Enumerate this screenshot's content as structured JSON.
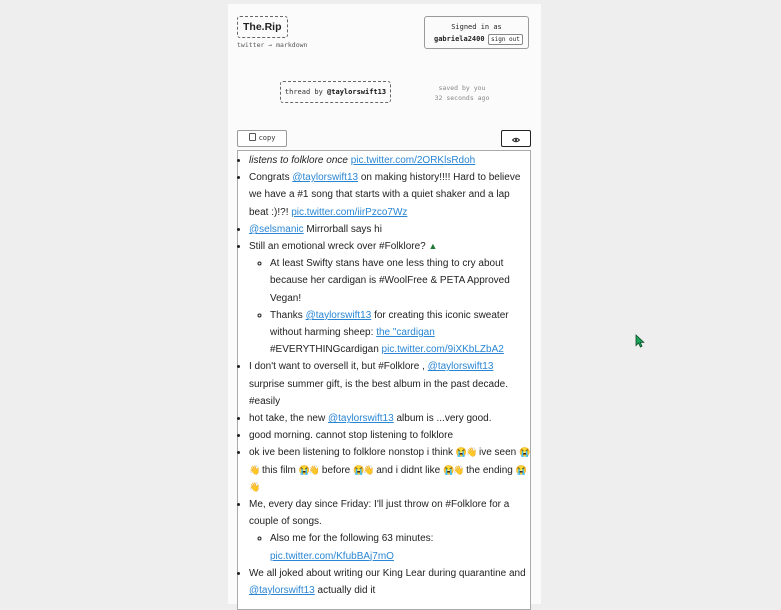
{
  "app": {
    "logo": "The.Rip",
    "tagline": "twitter → markdown"
  },
  "account": {
    "signed_in_label": "Signed in as",
    "username": "gabriela2400",
    "sign_out_label": "sign out"
  },
  "thread": {
    "prefix": "thread by",
    "handle": "@taylorswift13",
    "saved_line1": "saved by you",
    "saved_line2": "32 seconds ago"
  },
  "toolbar": {
    "copy_label": "copy",
    "copy_icon": "clipboard-icon",
    "view_icon": "eye-icon"
  },
  "tweets": {
    "t1": {
      "text": "listens to folklore once",
      "link": "pic.twitter.com/2ORKlsRdoh"
    },
    "t2": {
      "pre": "Congrats",
      "mention": "@taylorswift13",
      "post": "on making history!!!! Hard to believe we have a #1 song that starts with a quiet shaker and a lap beat :)!?!",
      "link": "pic.twitter.com/iirPzco7Wz"
    },
    "t3": {
      "mention": "@selsmanic",
      "post": "Mirrorball says hi"
    },
    "t4": {
      "text": "Still an emotional wreck over #Folklore?",
      "emoji": "evergreen-tree"
    },
    "t4a": {
      "text": "At least Swifty stans have one less thing to cry about because her cardigan is #WoolFree & PETA Approved Vegan!"
    },
    "t4b": {
      "pre": "Thanks",
      "mention": "@taylorswift13",
      "mid": "for creating this iconic sweater without harming sheep:",
      "link1": "the \"cardigan",
      "mid2": "#EVERYTHINGcardigan",
      "link2": "pic.twitter.com/9iXKbLZbA2"
    },
    "t5": {
      "pre": "I don't want to oversell it, but #Folklore ,",
      "mention": "@taylorswift13",
      "post": "surprise summer gift, is the best album in the past decade. #easily"
    },
    "t6": {
      "pre": "hot take, the new",
      "mention": "@taylorswift13",
      "post": "album is ...very good."
    },
    "t7": {
      "text": "good morning. cannot stop listening to folklore"
    },
    "t8": {
      "p1": "ok ive been listening to folklore nonstop i think",
      "p2": "ive seen",
      "p3": "this film",
      "p4": "before",
      "p5": "and i didnt like",
      "p6": "the ending",
      "emoji": "crying-face, waving-hand"
    },
    "t9": {
      "text": "Me, every day since Friday: I'll just throw on #Folklore for a couple of songs."
    },
    "t9a": {
      "text": "Also me for the following 63 minutes:",
      "link": "pic.twitter.com/KfubBAj7mO"
    },
    "t10": {
      "pre": "We all joked about writing our King Lear during quarantine and",
      "mention": "@taylorswift13",
      "post": "actually did it"
    }
  },
  "colors": {
    "link": "#2a86d4",
    "cursor": "#1aa35a"
  }
}
